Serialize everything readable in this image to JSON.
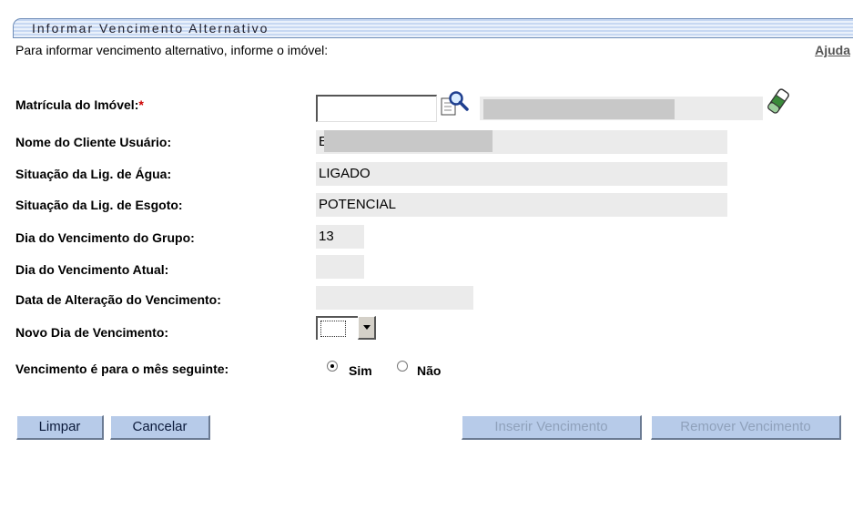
{
  "form": {
    "title": "Informar Vencimento Alternativo",
    "instructions": "Para informar vencimento alternativo, informe o imóvel:",
    "help_link": "Ajuda",
    "fields": {
      "matricula": {
        "label": "Matrícula do Imóvel:",
        "required_mark": "*",
        "value": ""
      },
      "cliente": {
        "label": "Nome do Cliente Usuário:",
        "value": "E"
      },
      "agua": {
        "label": "Situação da Lig. de Água:",
        "value": "LIGADO"
      },
      "esgoto": {
        "label": "Situação da Lig. de Esgoto:",
        "value": "POTENCIAL"
      },
      "dia_grupo": {
        "label": "Dia do Vencimento do Grupo:",
        "value": "13"
      },
      "dia_atual": {
        "label": "Dia do Vencimento Atual:",
        "value": ""
      },
      "data_alteracao": {
        "label": "Data de Alteração do Vencimento:",
        "value": ""
      },
      "novo_dia": {
        "label": "Novo Dia de Vencimento:",
        "value": ""
      },
      "mes_seguinte": {
        "label": "Vencimento é para o mês seguinte:",
        "options": [
          "Sim",
          "Não"
        ],
        "selected": "Sim"
      }
    },
    "buttons": {
      "limpar": "Limpar",
      "cancelar": "Cancelar",
      "inserir": "Inserir Vencimento",
      "remover": "Remover Vencimento"
    },
    "icons": {
      "search": "magnifier-icon",
      "clear": "eraser-icon"
    }
  }
}
